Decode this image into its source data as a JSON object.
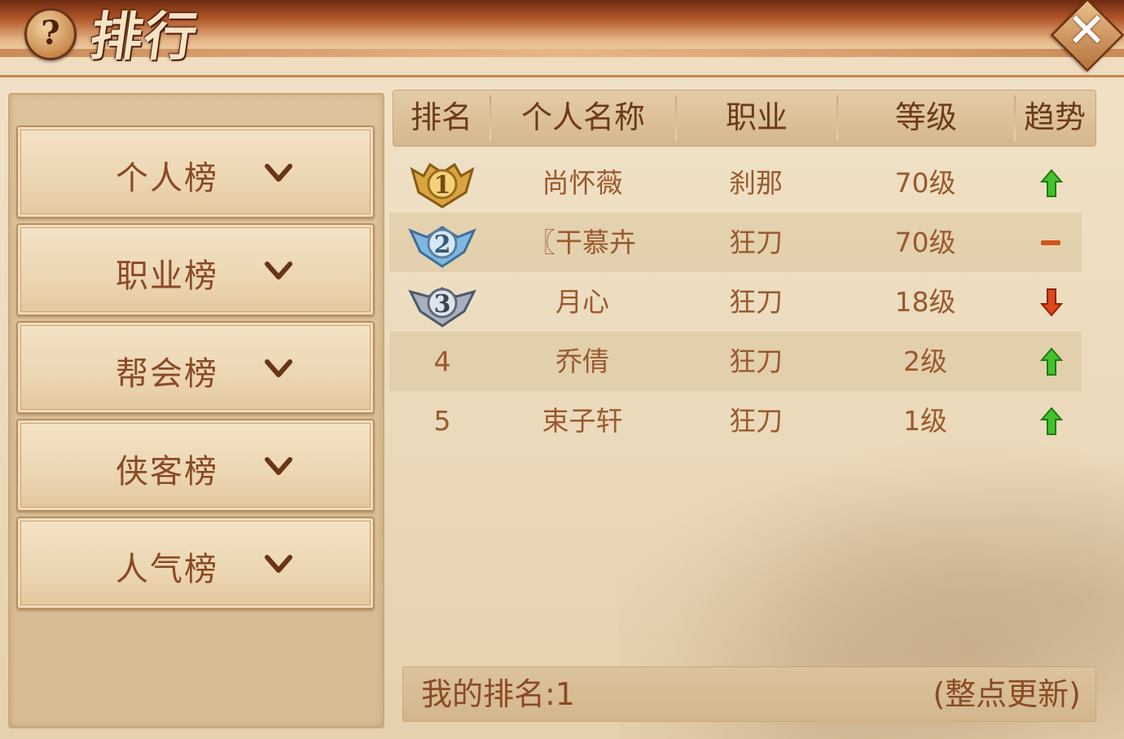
{
  "window": {
    "title": "排行",
    "help_symbol": "?",
    "close_symbol": "✕"
  },
  "tabs": [
    {
      "label": "个人榜",
      "icon": "chevron-down-icon"
    },
    {
      "label": "职业榜",
      "icon": "chevron-down-icon"
    },
    {
      "label": "帮会榜",
      "icon": "chevron-down-icon"
    },
    {
      "label": "侠客榜",
      "icon": "chevron-down-icon"
    },
    {
      "label": "人气榜",
      "icon": "chevron-down-icon"
    }
  ],
  "table": {
    "headers": {
      "rank": "排名",
      "name": "个人名称",
      "job": "职业",
      "level": "等级",
      "trend": "趋势"
    },
    "rows": [
      {
        "rank": "1",
        "rank_icon": "gold-medal-icon",
        "name": "尚怀薇",
        "job": "刹那",
        "level": "70级",
        "trend": "up"
      },
      {
        "rank": "2",
        "rank_icon": "silver-medal-icon",
        "name": "〖干慕卉",
        "job": "狂刀",
        "level": "70级",
        "trend": "same"
      },
      {
        "rank": "3",
        "rank_icon": "bronze-medal-icon",
        "name": "月心",
        "job": "狂刀",
        "level": "18级",
        "trend": "down"
      },
      {
        "rank": "4",
        "rank_icon": "",
        "name": "乔倩",
        "job": "狂刀",
        "level": "2级",
        "trend": "up"
      },
      {
        "rank": "5",
        "rank_icon": "",
        "name": "束子轩",
        "job": "狂刀",
        "level": "1级",
        "trend": "up"
      }
    ]
  },
  "footer": {
    "my_rank": "我的排名:1",
    "update_note": "(整点更新)"
  },
  "colors": {
    "trend_up": "#3fbf2a",
    "trend_down": "#e0461c",
    "trend_same": "#d0541f",
    "text_brown": "#9a5a2e"
  }
}
